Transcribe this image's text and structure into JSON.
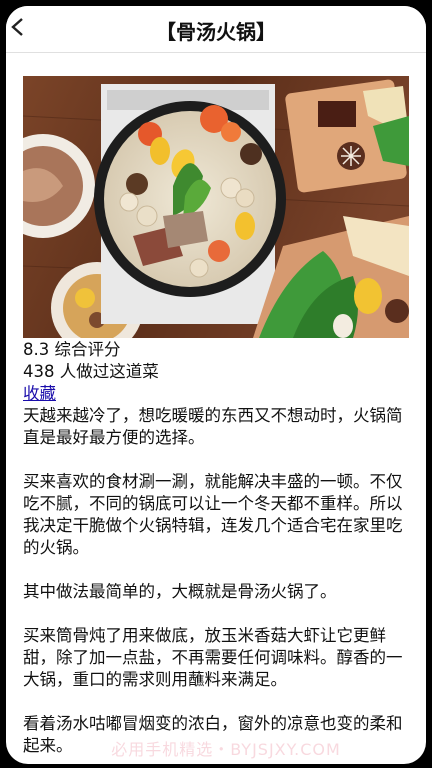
{
  "header": {
    "title": "【骨汤火锅】"
  },
  "image": {
    "subject": "hotpot-photo"
  },
  "recipe": {
    "rating_text": "8.3 综合评分",
    "made_count_text": "438 人做过这道菜",
    "favorite_label": "收藏"
  },
  "article": {
    "paragraphs": [
      "天越来越冷了，想吃暖暖的东西又不想动时，火锅简直是最好最方便的选择。",
      "买来喜欢的食材涮一涮，就能解决丰盛的一顿。不仅吃不腻，不同的锅底可以让一个冬天都不重样。所以我决定干脆做个火锅特辑，连发几个适合宅在家里吃的火锅。",
      "其中做法最简单的，大概就是骨汤火锅了。",
      "买来筒骨炖了用来做底，放玉米香菇大虾让它更鲜甜，除了加一点盐，不再需要任何调味料。醇香的一大锅，重口的需求则用蘸料来满足。",
      "看着汤水咕嘟冒烟变的浓白，窗外的凉意也变的柔和起来。"
    ]
  },
  "watermark": {
    "text": "必用手机精选・BYJSJXY.COM"
  },
  "colors": {
    "link": "#1a0dab",
    "table_wood": "#6b3a22",
    "broth": "#e8e2d2"
  }
}
